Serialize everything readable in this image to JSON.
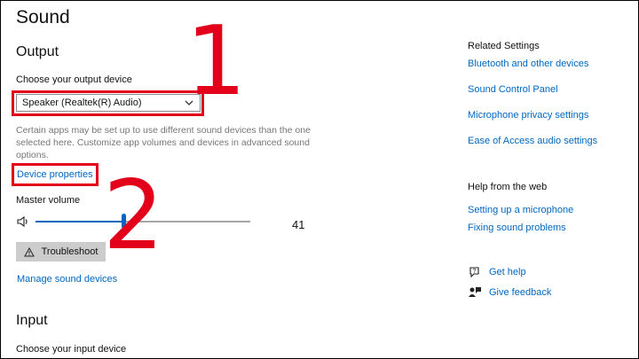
{
  "page": {
    "title": "Sound"
  },
  "output": {
    "heading": "Output",
    "choose_label": "Choose your output device",
    "device_value": "Speaker (Realtek(R) Audio)",
    "info_text_1": "Certain apps may be set up to use different sound devices than the one",
    "info_text_2": "selected here. Customize app volumes and devices in advanced sound",
    "info_text_3": "options.",
    "device_properties": "Device properties",
    "master_volume_label": "Master volume",
    "volume": 41,
    "volume_text": "41",
    "troubleshoot": "Troubleshoot",
    "manage": "Manage sound devices"
  },
  "input": {
    "heading": "Input",
    "choose_label": "Choose your input device"
  },
  "annotations": {
    "one": "1",
    "two": "2",
    "color": "#e3001b"
  },
  "related": {
    "heading": "Related Settings",
    "links": [
      "Bluetooth and other devices",
      "Sound Control Panel",
      "Microphone privacy settings",
      "Ease of Access audio settings"
    ]
  },
  "help": {
    "heading": "Help from the web",
    "links": [
      "Setting up a microphone",
      "Fixing sound problems"
    ]
  },
  "support": {
    "get_help": "Get help",
    "give_feedback": "Give feedback"
  },
  "colors": {
    "accent": "#0067c0",
    "annotation": "#e3001b",
    "button_bg": "#cccccc"
  }
}
